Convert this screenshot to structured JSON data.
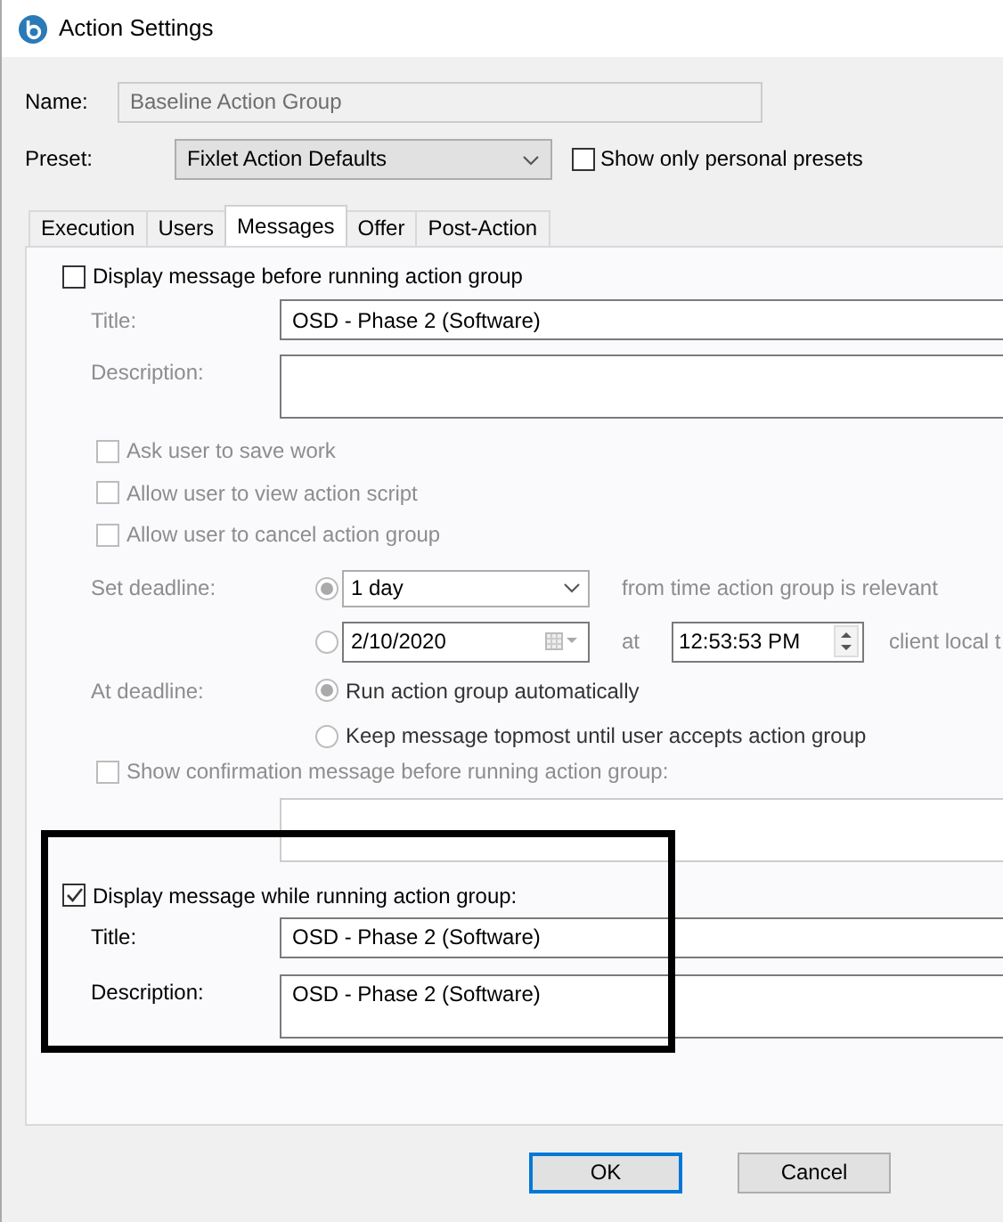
{
  "window": {
    "title": "Action Settings"
  },
  "name_field": {
    "label": "Name:",
    "value": "Baseline Action Group",
    "disabled": true
  },
  "preset": {
    "label": "Preset:",
    "value": "Fixlet Action Defaults"
  },
  "personal_presets": {
    "label": "Show only personal presets",
    "checked": false
  },
  "tabs": [
    {
      "label": "Execution",
      "selected": false
    },
    {
      "label": "Users",
      "selected": false
    },
    {
      "label": "Messages",
      "selected": true
    },
    {
      "label": "Offer",
      "selected": false
    },
    {
      "label": "Post-Action",
      "selected": false
    }
  ],
  "before_message": {
    "label": "Display message before running action group",
    "checked": false,
    "title": {
      "label": "Title:",
      "value": "OSD - Phase 2 (Software)"
    },
    "description": {
      "label": "Description:"
    },
    "options": [
      {
        "label": "Ask user to save work",
        "checked": false
      },
      {
        "label": "Allow user to view action script",
        "checked": false
      },
      {
        "label": "Allow user to cancel action group",
        "checked": false
      }
    ],
    "deadline": {
      "label": "Set deadline:",
      "choices": [
        {
          "kind": "duration",
          "selected": true,
          "value": "1 day",
          "suffix": "from time action group is relevant"
        },
        {
          "kind": "date",
          "selected": false,
          "value": "2/10/2020",
          "at": "at",
          "time": "12:53:53 PM",
          "suffix": "client local t"
        }
      ]
    },
    "at_deadline": {
      "label": "At deadline:",
      "choices": [
        {
          "label": "Run action group automatically",
          "selected": true
        },
        {
          "label": "Keep message topmost until user accepts action group",
          "selected": false
        }
      ]
    },
    "confirmation": {
      "label": "Show confirmation message before running action group:",
      "checked": false
    }
  },
  "while_message": {
    "label": "Display message while running action group:",
    "checked": true,
    "highlighted": true,
    "title": {
      "label": "Title:",
      "value": "OSD - Phase 2 (Software)"
    },
    "description": {
      "label": "Description:",
      "value": "OSD - Phase 2 (Software)"
    }
  },
  "buttons": [
    {
      "label": "OK",
      "default": true
    },
    {
      "label": "Cancel",
      "default": false
    }
  ]
}
